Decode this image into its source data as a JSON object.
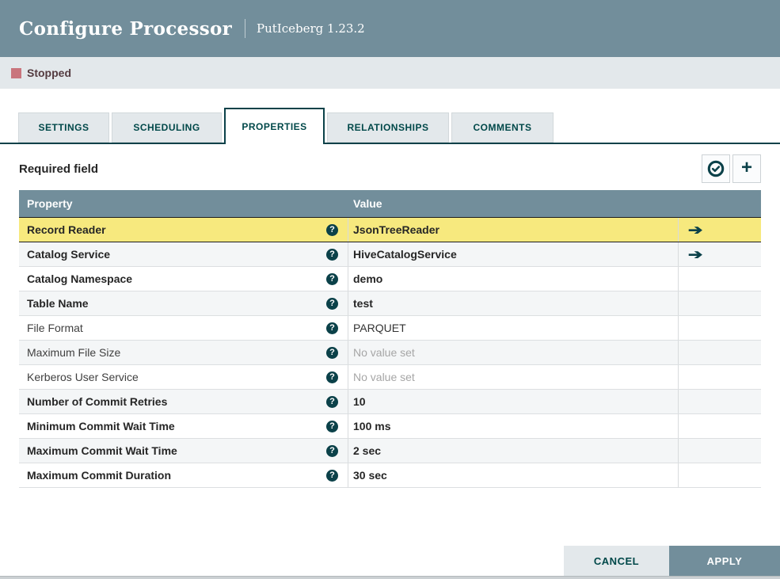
{
  "dialog": {
    "title": "Configure Processor",
    "subtitle": "PutIceberg 1.23.2"
  },
  "status": {
    "label": "Stopped",
    "color": "#c9757d"
  },
  "tabs": [
    {
      "label": "SETTINGS",
      "active": false
    },
    {
      "label": "SCHEDULING",
      "active": false
    },
    {
      "label": "PROPERTIES",
      "active": true
    },
    {
      "label": "RELATIONSHIPS",
      "active": false
    },
    {
      "label": "COMMENTS",
      "active": false
    }
  ],
  "properties_panel": {
    "required_note": "Required field",
    "toolbar_icons": [
      {
        "name": "verify-properties-icon",
        "glyph": "check-circle"
      },
      {
        "name": "add-property-icon",
        "glyph": "plus"
      }
    ]
  },
  "table": {
    "columns": [
      "Property",
      "Value"
    ],
    "rows": [
      {
        "property": "Record Reader",
        "value": "JsonTreeReader",
        "required": true,
        "no_value": false,
        "goto": true,
        "highlighted": true
      },
      {
        "property": "Catalog Service",
        "value": "HiveCatalogService",
        "required": true,
        "no_value": false,
        "goto": true,
        "highlighted": false
      },
      {
        "property": "Catalog Namespace",
        "value": "demo",
        "required": true,
        "no_value": false,
        "goto": false,
        "highlighted": false
      },
      {
        "property": "Table Name",
        "value": "test",
        "required": true,
        "no_value": false,
        "goto": false,
        "highlighted": false
      },
      {
        "property": "File Format",
        "value": "PARQUET",
        "required": false,
        "no_value": false,
        "goto": false,
        "highlighted": false
      },
      {
        "property": "Maximum File Size",
        "value": "No value set",
        "required": false,
        "no_value": true,
        "goto": false,
        "highlighted": false
      },
      {
        "property": "Kerberos User Service",
        "value": "No value set",
        "required": false,
        "no_value": true,
        "goto": false,
        "highlighted": false
      },
      {
        "property": "Number of Commit Retries",
        "value": "10",
        "required": true,
        "no_value": false,
        "goto": false,
        "highlighted": false
      },
      {
        "property": "Minimum Commit Wait Time",
        "value": "100 ms",
        "required": true,
        "no_value": false,
        "goto": false,
        "highlighted": false
      },
      {
        "property": "Maximum Commit Wait Time",
        "value": "2 sec",
        "required": true,
        "no_value": false,
        "goto": false,
        "highlighted": false
      },
      {
        "property": "Maximum Commit Duration",
        "value": "30 sec",
        "required": true,
        "no_value": false,
        "goto": false,
        "highlighted": false
      }
    ]
  },
  "footer": {
    "cancel_label": "CANCEL",
    "apply_label": "APPLY"
  },
  "colors": {
    "header_bg": "#728e9b",
    "accent": "#004849",
    "highlight_row": "#f7e97e",
    "status_stopped": "#c9757d",
    "strip_bg": "#e3e8eb"
  }
}
